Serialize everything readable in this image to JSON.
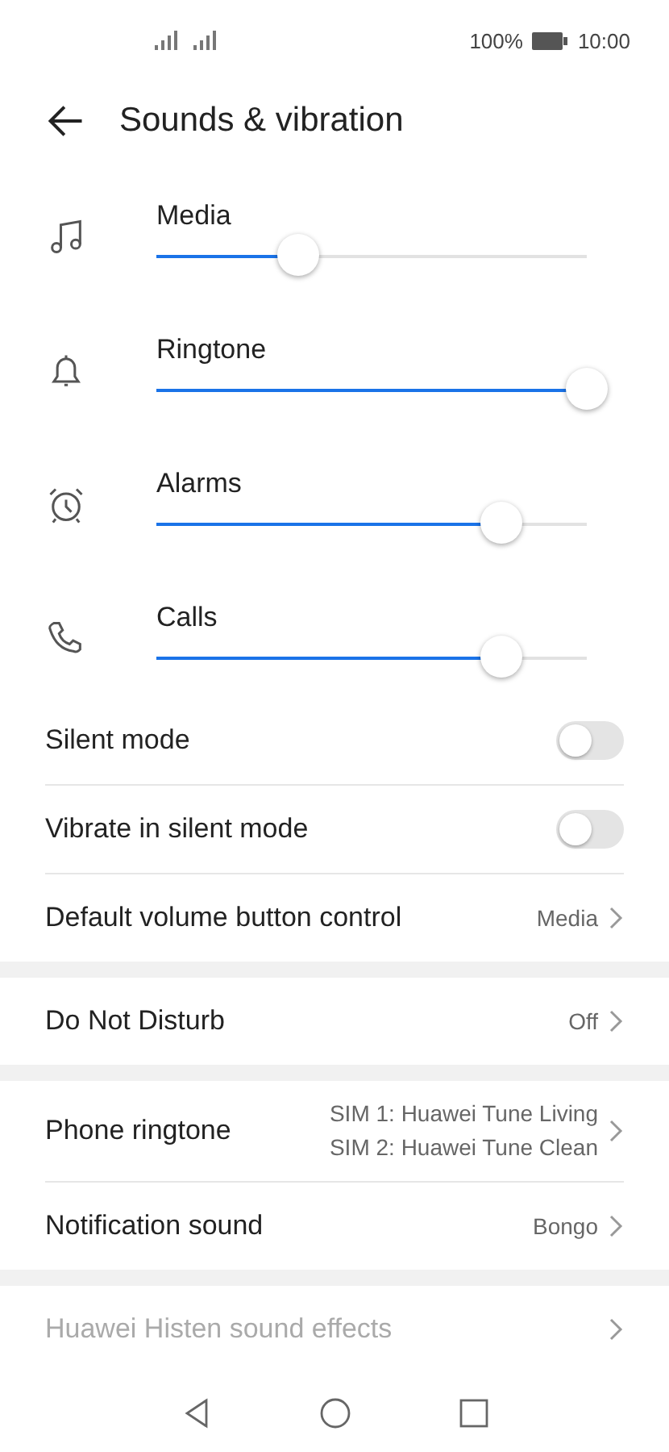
{
  "status_bar": {
    "battery": "100%",
    "time": "10:00"
  },
  "header": {
    "title": "Sounds & vibration"
  },
  "volumes": [
    {
      "kind": "music",
      "name": "Media",
      "level": 0.33
    },
    {
      "kind": "bell",
      "name": "Ringtone",
      "level": 1.0
    },
    {
      "kind": "alarm",
      "name": "Alarms",
      "level": 0.8
    },
    {
      "kind": "phone",
      "name": "Calls",
      "level": 0.8
    }
  ],
  "groups": [
    {
      "items": [
        {
          "kind": "toggle",
          "label": "Silent mode",
          "on": false
        },
        {
          "kind": "toggle",
          "label": "Vibrate in silent mode",
          "on": false
        },
        {
          "kind": "link",
          "label": "Default volume button control",
          "value": "Media"
        }
      ]
    },
    {
      "items": [
        {
          "kind": "link",
          "label": "Do Not Disturb",
          "value": "Off"
        }
      ]
    },
    {
      "items": [
        {
          "kind": "link",
          "label": "Phone ringtone",
          "values": [
            "SIM 1: Huawei Tune Living",
            "SIM 2: Huawei Tune Clean"
          ]
        },
        {
          "kind": "link",
          "label": "Notification sound",
          "value": "Bongo"
        }
      ]
    },
    {
      "items": [
        {
          "kind": "link",
          "label": "Huawei Histen sound effects",
          "disabled": true
        }
      ]
    }
  ]
}
